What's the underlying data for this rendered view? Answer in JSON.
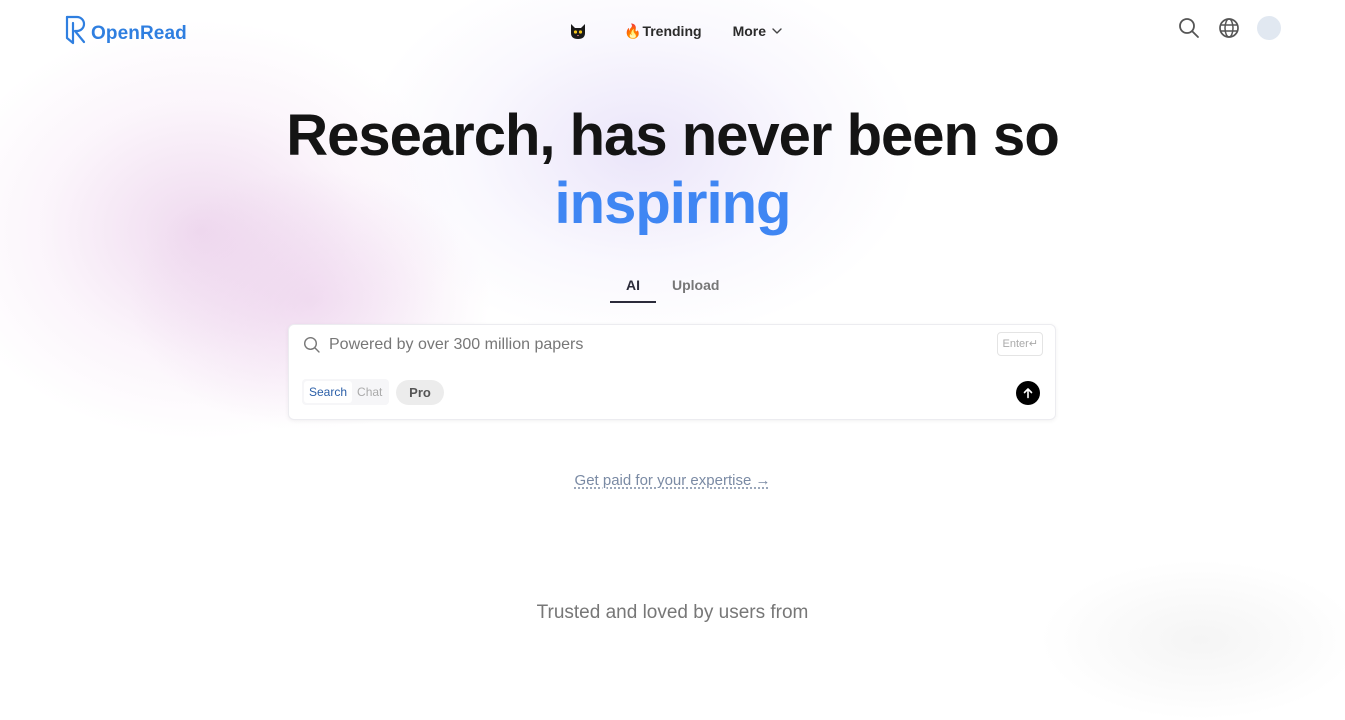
{
  "header": {
    "logo_text": "OpenRead",
    "nav": {
      "cat_icon": "black-cat-icon",
      "trending_icon": "🔥",
      "trending_label": "Trending",
      "more_label": "More"
    },
    "actions": {
      "search_icon": "search-icon",
      "language_icon": "globe-icon"
    }
  },
  "hero": {
    "line1": "Research, has never been so",
    "line2": "inspiring"
  },
  "tabs": [
    {
      "label": "AI",
      "active": true
    },
    {
      "label": "Upload",
      "active": false
    }
  ],
  "search": {
    "placeholder": "Powered by over 300 million papers",
    "value": "",
    "enter_hint": "Enter↵",
    "modes": [
      "Search",
      "Chat"
    ],
    "selected_mode": "Search",
    "pro_label": "Pro"
  },
  "promo_link": "Get paid for your expertise →",
  "trusted_text": "Trusted and loved by users from",
  "colors": {
    "brand": "#2f7fe0",
    "accent": "#3f86f3",
    "heading": "#141414"
  }
}
